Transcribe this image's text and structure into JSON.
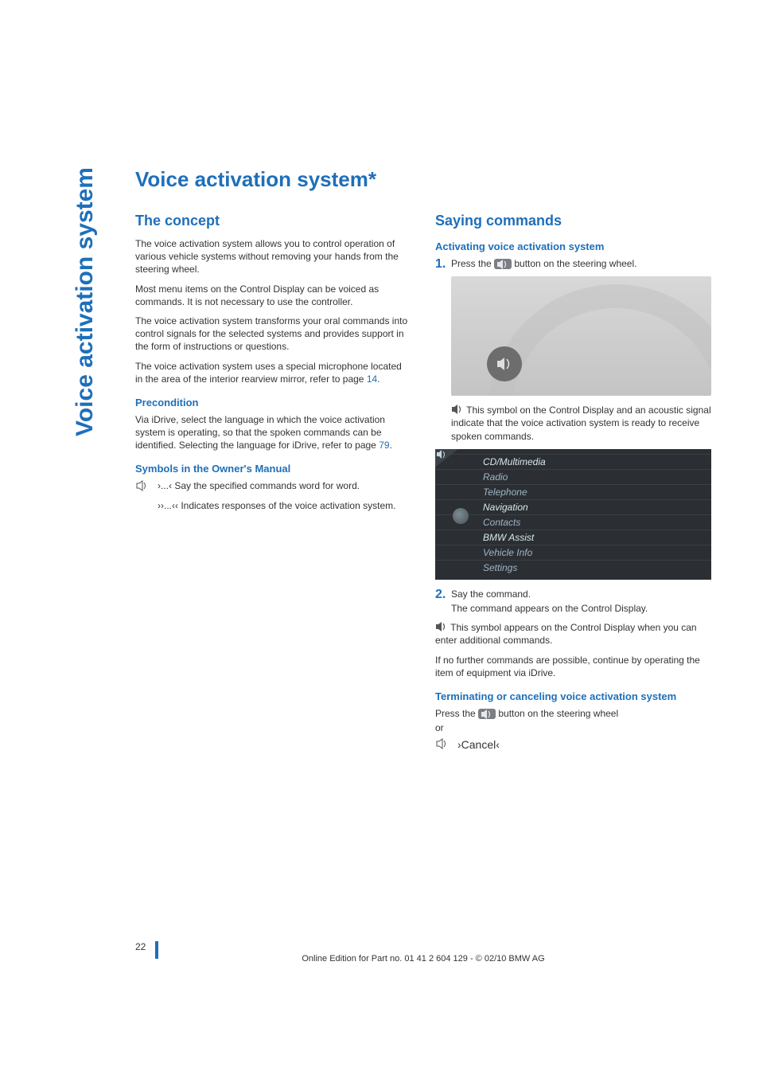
{
  "side_tab": "Voice activation system",
  "title": "Voice activation system*",
  "left": {
    "h_concept": "The concept",
    "p1": "The voice activation system allows you to control operation of various vehicle systems without removing your hands from the steering wheel.",
    "p2": "Most menu items on the Control Display can be voiced as commands. It is not necessary to use the controller.",
    "p3": "The voice activation system transforms your oral commands into control signals for the selected systems and provides support in the form of instructions or questions.",
    "p4a": "The voice activation system uses a special microphone located in the area of the interior rearview mirror, refer to page ",
    "p4_link": "14",
    "p4b": ".",
    "h_precond": "Precondition",
    "precond_a": "Via iDrive, select the language in which the voice activation system is operating, so that the spoken commands can be identified. Selecting the language for iDrive, refer to page ",
    "precond_link": "79",
    "precond_b": ".",
    "h_symbols": "Symbols in the Owner's Manual",
    "sym1": "›...‹ Say the specified commands word for word.",
    "sym2": "››...‹‹ Indicates responses of the voice activation system."
  },
  "right": {
    "h_saying": "Saying commands",
    "h_activating": "Activating voice activation system",
    "step1_num": "1.",
    "step1a": "Press the ",
    "step1b": " button on the steering wheel.",
    "after_wheel": " This symbol on the Control Display and an acoustic signal indicate that the voice activation system is ready to receive spoken commands.",
    "menu": {
      "items": [
        "CD/Multimedia",
        "Radio",
        "Telephone",
        "Navigation",
        "Contacts",
        "BMW Assist",
        "Vehicle Info",
        "Settings"
      ]
    },
    "step2_num": "2.",
    "step2_a": "Say the command.",
    "step2_b": "The command appears on the Control Display.",
    "after_menu": " This symbol appears on the Control Display when you can enter additional commands.",
    "no_further": "If no further commands are possible, continue by operating the item of equipment via iDrive.",
    "h_terminate": "Terminating or canceling voice activation system",
    "term_a": "Press the ",
    "term_b": " button on the steering wheel",
    "term_or": "or",
    "cancel": "›Cancel‹"
  },
  "footer": {
    "page": "22",
    "text": "Online Edition for Part no. 01 41 2 604 129 - © 02/10 BMW AG"
  }
}
